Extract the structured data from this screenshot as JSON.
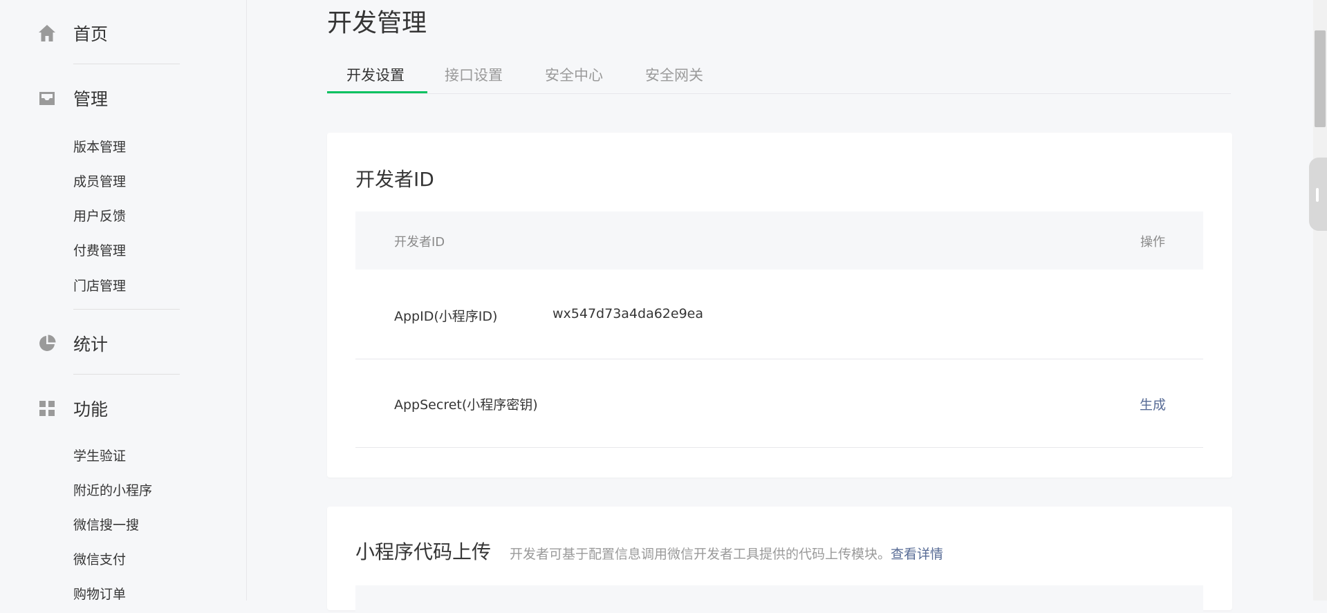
{
  "sidebar": {
    "home": {
      "label": "首页",
      "icon": "home-icon"
    },
    "manage": {
      "label": "管理",
      "icon": "inbox-icon",
      "items": [
        "版本管理",
        "成员管理",
        "用户反馈",
        "付费管理",
        "门店管理"
      ]
    },
    "stats": {
      "label": "统计",
      "icon": "pie-chart-icon"
    },
    "features": {
      "label": "功能",
      "icon": "grid-icon",
      "items": [
        "学生验证",
        "附近的小程序",
        "微信搜一搜",
        "微信支付",
        "购物订单"
      ]
    }
  },
  "main": {
    "title": "开发管理",
    "tabs": [
      "开发设置",
      "接口设置",
      "安全中心",
      "安全网关"
    ],
    "developer_id_card": {
      "title": "开发者ID",
      "headers": {
        "name": "开发者ID",
        "action": "操作"
      },
      "rows": [
        {
          "name": "AppID(小程序ID)",
          "value": "wx547d73a4da62e9ea",
          "action": ""
        },
        {
          "name": "AppSecret(小程序密钥)",
          "value": "",
          "action": "生成"
        }
      ]
    },
    "upload_card": {
      "title": "小程序代码上传",
      "desc": "开发者可基于配置信息调用微信开发者工具提供的代码上传模块。",
      "link": "查看详情"
    }
  },
  "colors": {
    "accent": "#07c160",
    "link": "#576b95",
    "bg": "#f6f7f9"
  }
}
